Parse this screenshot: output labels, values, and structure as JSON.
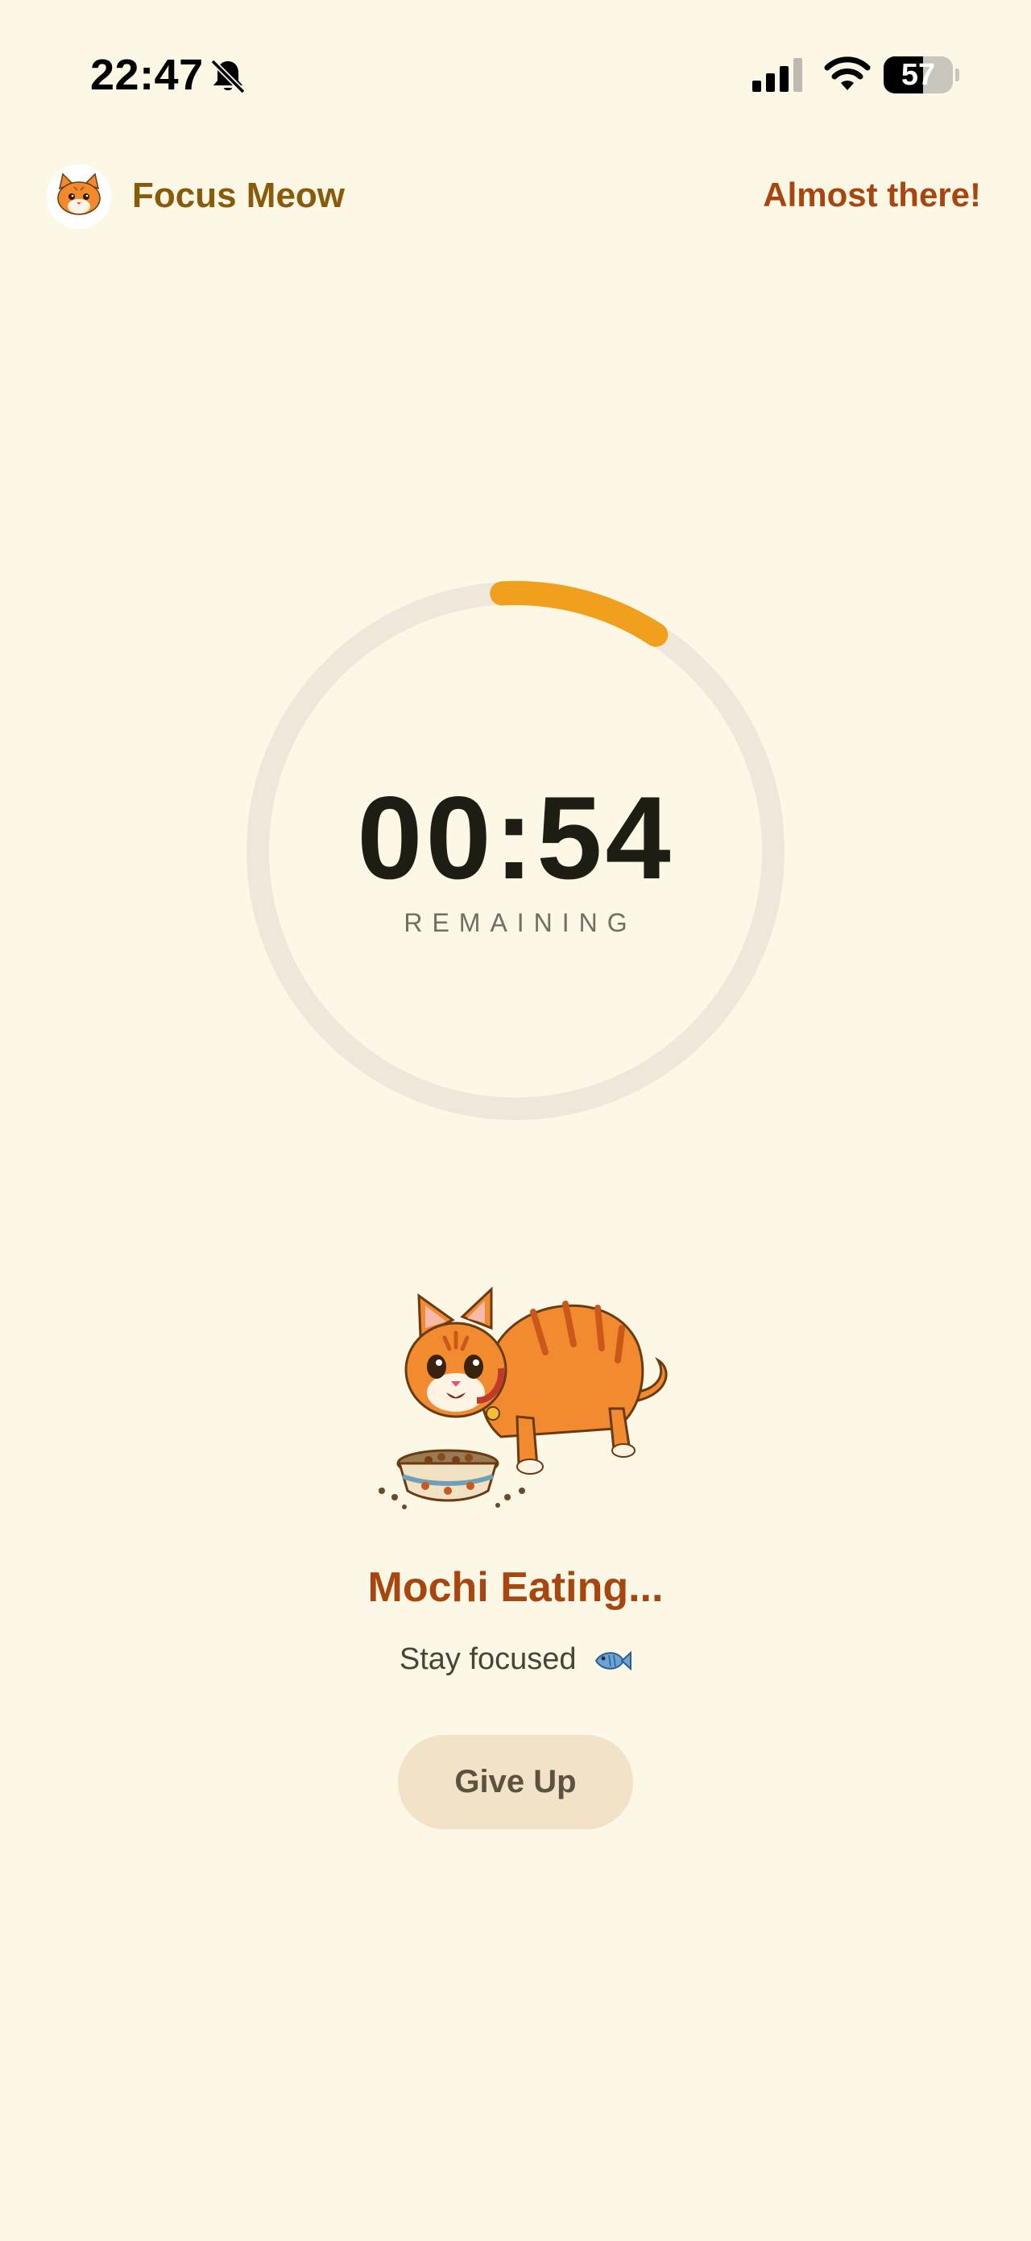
{
  "status_bar": {
    "time": "22:47",
    "battery_level": "57",
    "bell_icon": "bell-slash-icon",
    "signal_icon": "cellular-signal-icon",
    "wifi_icon": "wifi-icon"
  },
  "header": {
    "app_title": "Focus Meow",
    "logo_icon": "cat-face-icon",
    "status_message": "Almost there!"
  },
  "timer": {
    "value": "00:54",
    "label": "REMAINING",
    "progress_fraction": 0.1,
    "track_color": "#EDE8DA",
    "progress_color": "#F0A01C"
  },
  "cat": {
    "illustration_icon": "cat-eating-illustration",
    "status": "Mochi Eating...",
    "subtitle": "Stay focused",
    "subtitle_icon": "fish-icon"
  },
  "actions": {
    "give_up_label": "Give Up"
  },
  "colors": {
    "background": "#FDF7E6",
    "accent_orange": "#F0A01C",
    "title_brown": "#8A5A0B",
    "rust": "#A8460F",
    "button_bg": "#F1E2C8"
  }
}
